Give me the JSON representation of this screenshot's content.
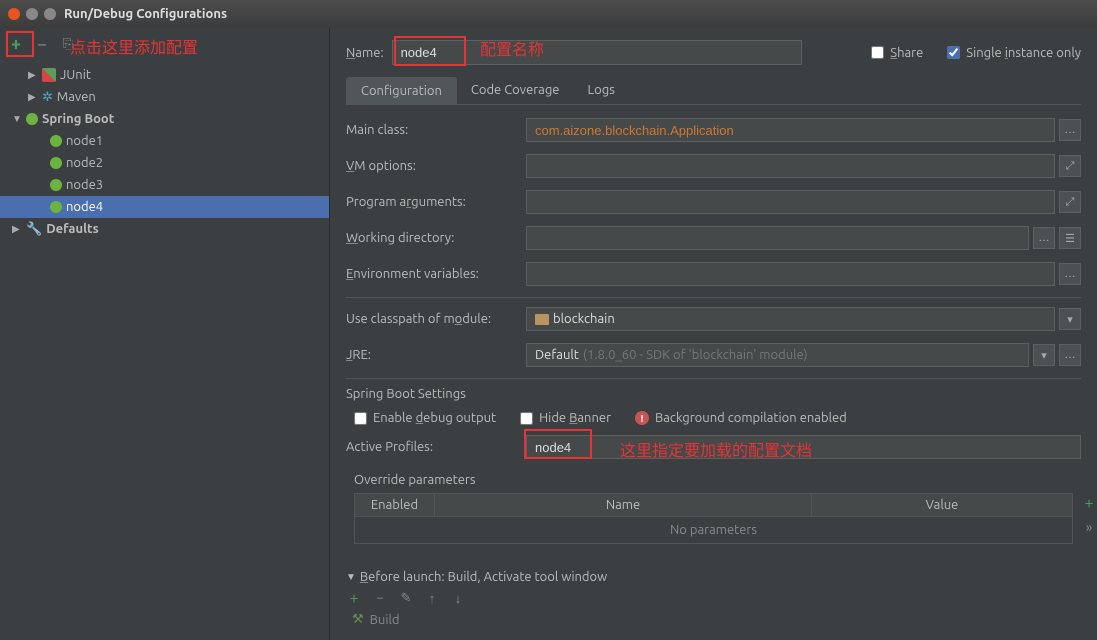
{
  "window": {
    "title": "Run/Debug Configurations"
  },
  "annotations": {
    "add_hint": "点击这里添加配置",
    "name_hint": "配置名称",
    "profiles_hint": "这里指定要加载的配置文档"
  },
  "toolbar": {
    "plus": "+",
    "minus": "−",
    "copy": "⎘"
  },
  "tree": {
    "junit": "JUnit",
    "maven": "Maven",
    "spring_boot": "Spring Boot",
    "nodes": [
      "node1",
      "node2",
      "node3",
      "node4"
    ],
    "defaults": "Defaults"
  },
  "form": {
    "name_label": "Name:",
    "name_value": "node4",
    "share_label": "Share",
    "single_instance_label": "Single instance only",
    "tabs": {
      "config": "Configuration",
      "coverage": "Code Coverage",
      "logs": "Logs"
    },
    "main_class_label": "Main class:",
    "main_class_value": "com.aizone.blockchain.Application",
    "vm_options_label": "VM options:",
    "program_args_label": "Program arguments:",
    "working_dir_label": "Working directory:",
    "env_vars_label": "Environment variables:",
    "classpath_label": "Use classpath of module:",
    "classpath_value": "blockchain",
    "jre_label": "JRE:",
    "jre_value": "Default",
    "jre_hint": "(1.8.0_60 - SDK of 'blockchain' module)",
    "spring_settings": "Spring Boot Settings",
    "enable_debug": "Enable debug output",
    "hide_banner": "Hide Banner",
    "bg_compilation": "Background compilation enabled",
    "active_profiles_label": "Active Profiles:",
    "active_profiles_value": "node4",
    "override_title": "Override parameters",
    "override_cols": {
      "enabled": "Enabled",
      "name": "Name",
      "value": "Value"
    },
    "no_params": "No parameters",
    "before_launch": "Before launch: Build, Activate tool window",
    "build_item": "Build"
  }
}
